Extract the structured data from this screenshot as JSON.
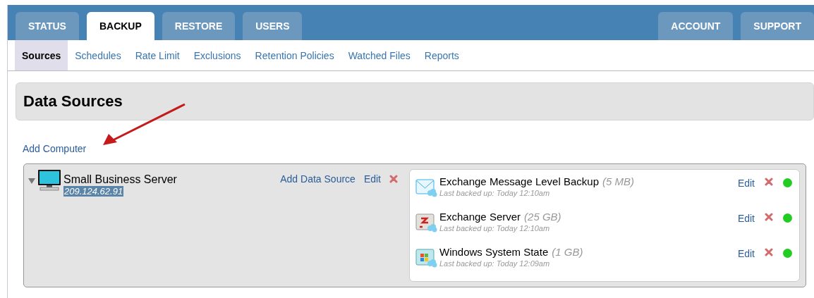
{
  "main_tabs": [
    {
      "label": "STATUS",
      "selected": false
    },
    {
      "label": "BACKUP",
      "selected": true
    },
    {
      "label": "RESTORE",
      "selected": false
    },
    {
      "label": "USERS",
      "selected": false
    }
  ],
  "right_tabs": [
    {
      "label": "ACCOUNT",
      "selected": false
    },
    {
      "label": "SUPPORT",
      "selected": false
    }
  ],
  "sub_tabs": [
    {
      "label": "Sources",
      "selected": true
    },
    {
      "label": "Schedules",
      "selected": false
    },
    {
      "label": "Rate Limit",
      "selected": false
    },
    {
      "label": "Exclusions",
      "selected": false
    },
    {
      "label": "Retention Policies",
      "selected": false
    },
    {
      "label": "Watched Files",
      "selected": false
    },
    {
      "label": "Reports",
      "selected": false
    }
  ],
  "heading": "Data Sources",
  "add_computer": "Add Computer",
  "computer": {
    "name": "Small Business Server",
    "address": "209.124.62.91",
    "expanded": true,
    "add_source": "Add Data Source",
    "edit": "Edit",
    "sources": [
      {
        "kind": "mail",
        "name": "Exchange Message Level Backup",
        "size": "(5 MB)",
        "last_backup": "Last backed up: Today 12:10am",
        "edit": "Edit",
        "color": "#22cc22"
      },
      {
        "kind": "exchange",
        "name": "Exchange Server",
        "size": "(25 GB)",
        "last_backup": "Last backed up: Today 12:10am",
        "edit": "Edit",
        "color": "#22cc22"
      },
      {
        "kind": "windows",
        "name": "Windows System State",
        "size": "(1 GB)",
        "last_backup": "Last backed up: Today 12:09am",
        "edit": "Edit",
        "color": "#22cc22"
      }
    ]
  }
}
